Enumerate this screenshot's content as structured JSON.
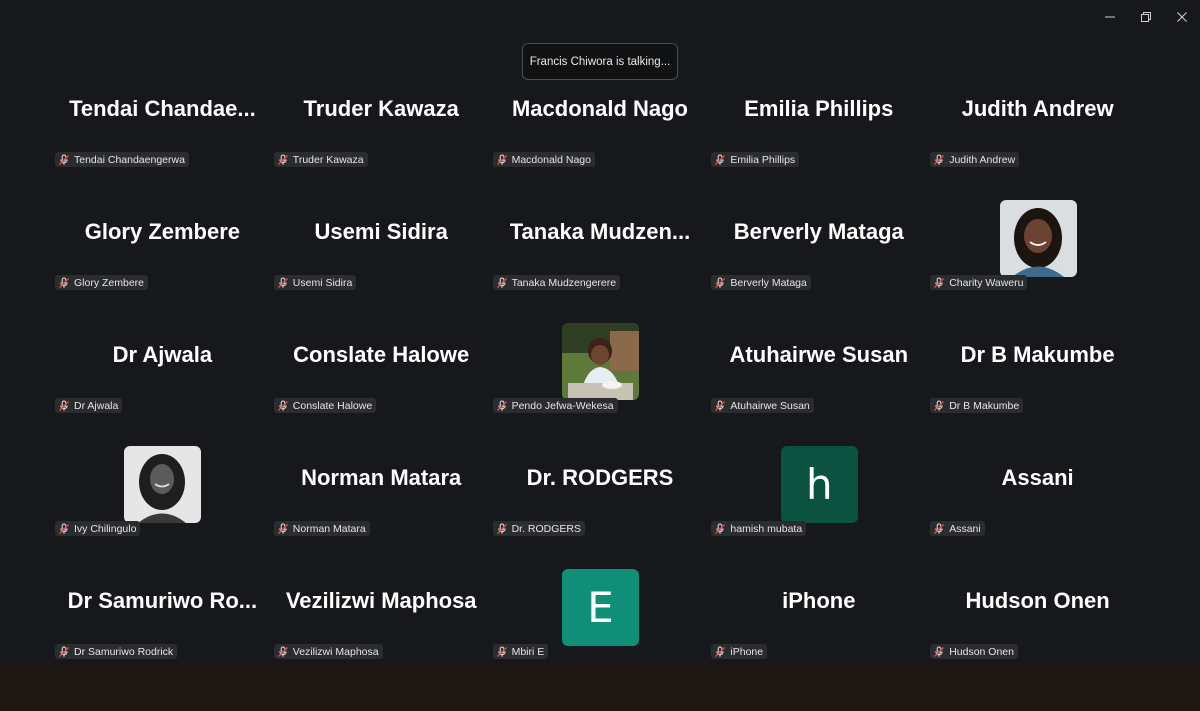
{
  "window": {
    "controls": {
      "minimize": "minimize-icon",
      "restore": "restore-icon",
      "close": "close-icon"
    }
  },
  "toast": {
    "text": "Francis Chiwora is talking..."
  },
  "colors": {
    "background": "#16181b",
    "muted_mic": "#e0473f",
    "tag_bg": "#2a2c30",
    "avatar_h": "#0b5340",
    "avatar_e": "#0f8f77",
    "bottom_bar": "#1c1712"
  },
  "participants": [
    {
      "display": "Tendai  Chandae...",
      "tag": "Tendai Chandaengerwa",
      "muted": true
    },
    {
      "display": "Truder Kawaza",
      "tag": "Truder Kawaza",
      "muted": true
    },
    {
      "display": "Macdonald Nago",
      "tag": "Macdonald Nago",
      "muted": true
    },
    {
      "display": "Emilia Phillips",
      "tag": "Emilia Phillips",
      "muted": true
    },
    {
      "display": "Judith Andrew",
      "tag": "Judith Andrew",
      "muted": true
    },
    {
      "display": "Glory Zembere",
      "tag": "Glory Zembere",
      "muted": true
    },
    {
      "display": "Usemi Sidira",
      "tag": "Usemi Sidira",
      "muted": true
    },
    {
      "display": "Tanaka  Mudzen...",
      "tag": "Tanaka Mudzengerere",
      "muted": true
    },
    {
      "display": "Berverly Mataga",
      "tag": "Berverly Mataga",
      "muted": true
    },
    {
      "display": "",
      "tag": "Charity Waweru",
      "muted": true,
      "avatar": "photo-woman-smiling"
    },
    {
      "display": "Dr Ajwala",
      "tag": "Dr Ajwala",
      "muted": true
    },
    {
      "display": "Conslate Halowe",
      "tag": "Conslate Halowe",
      "muted": true
    },
    {
      "display": "",
      "tag": "Pendo Jefwa-Wekesa",
      "muted": true,
      "avatar": "photo-child-eating"
    },
    {
      "display": "Atuhairwe Susan",
      "tag": "Atuhairwe Susan",
      "muted": true
    },
    {
      "display": "Dr B Makumbe",
      "tag": "Dr B Makumbe",
      "muted": true
    },
    {
      "display": "",
      "tag": "Ivy Chilingulo",
      "muted": true,
      "avatar": "photo-woman-bw"
    },
    {
      "display": "Norman Matara",
      "tag": "Norman Matara",
      "muted": true
    },
    {
      "display": "Dr. RODGERS",
      "tag": "Dr. RODGERS",
      "muted": true
    },
    {
      "display": "",
      "tag": "hamish mubata",
      "muted": true,
      "avatar_letter": "h",
      "avatar_color": "#0b5340"
    },
    {
      "display": "Assani",
      "tag": "Assani",
      "muted": true
    },
    {
      "display": "Dr Samuriwo  Ro...",
      "tag": "Dr Samuriwo Rodrick",
      "muted": true
    },
    {
      "display": "Vezilizwi Maphosa",
      "tag": "Vezilizwi Maphosa",
      "muted": true
    },
    {
      "display": "",
      "tag": "Mbiri E",
      "muted": true,
      "avatar_letter": "E",
      "avatar_color": "#0f8f77"
    },
    {
      "display": "iPhone",
      "tag": "iPhone",
      "muted": true
    },
    {
      "display": "Hudson Onen",
      "tag": "Hudson Onen",
      "muted": true
    }
  ]
}
